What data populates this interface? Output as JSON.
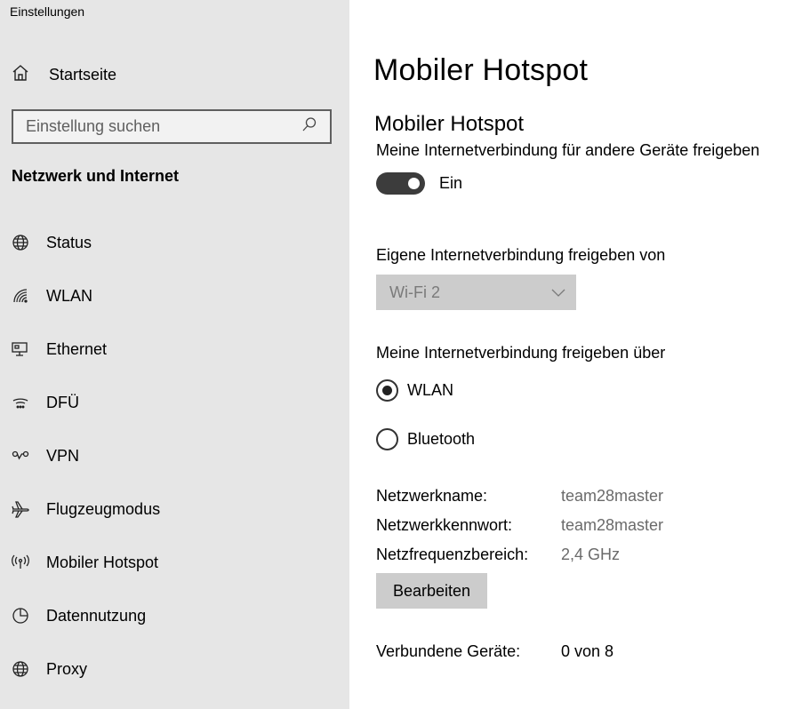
{
  "app": {
    "title": "Einstellungen"
  },
  "sidebar": {
    "home_label": "Startseite",
    "search_placeholder": "Einstellung suchen",
    "section_title": "Netzwerk und Internet",
    "items": [
      {
        "label": "Status",
        "icon": "globe-icon"
      },
      {
        "label": "WLAN",
        "icon": "wifi-icon"
      },
      {
        "label": "Ethernet",
        "icon": "ethernet-icon"
      },
      {
        "label": "DFÜ",
        "icon": "dialup-icon"
      },
      {
        "label": "VPN",
        "icon": "vpn-icon"
      },
      {
        "label": "Flugzeugmodus",
        "icon": "airplane-icon"
      },
      {
        "label": "Mobiler Hotspot",
        "icon": "hotspot-icon"
      },
      {
        "label": "Datennutzung",
        "icon": "data-usage-icon"
      },
      {
        "label": "Proxy",
        "icon": "globe-icon"
      }
    ]
  },
  "main": {
    "page_title": "Mobiler Hotspot",
    "section_title": "Mobiler Hotspot",
    "share_label": "Meine Internetverbindung für andere Geräte freigeben",
    "toggle_state": "Ein",
    "share_from_label": "Eigene Internetverbindung freigeben von",
    "share_from_value": "Wi-Fi 2",
    "share_over_label": "Meine Internetverbindung freigeben über",
    "radio_options": [
      {
        "label": "WLAN",
        "checked": true
      },
      {
        "label": "Bluetooth",
        "checked": false
      }
    ],
    "network_name_label": "Netzwerkname:",
    "network_name_value": "team28master",
    "network_password_label": "Netzwerkkennwort:",
    "network_password_value": "team28master",
    "band_label": "Netzfrequenzbereich:",
    "band_value": "2,4 GHz",
    "edit_button": "Bearbeiten",
    "connected_label": "Verbundene Geräte:",
    "connected_value": "0 von 8"
  },
  "colors": {
    "sidebar_bg": "#e6e6e6",
    "toggle_on": "#3c3c3c",
    "control_gray": "#cccccc"
  }
}
